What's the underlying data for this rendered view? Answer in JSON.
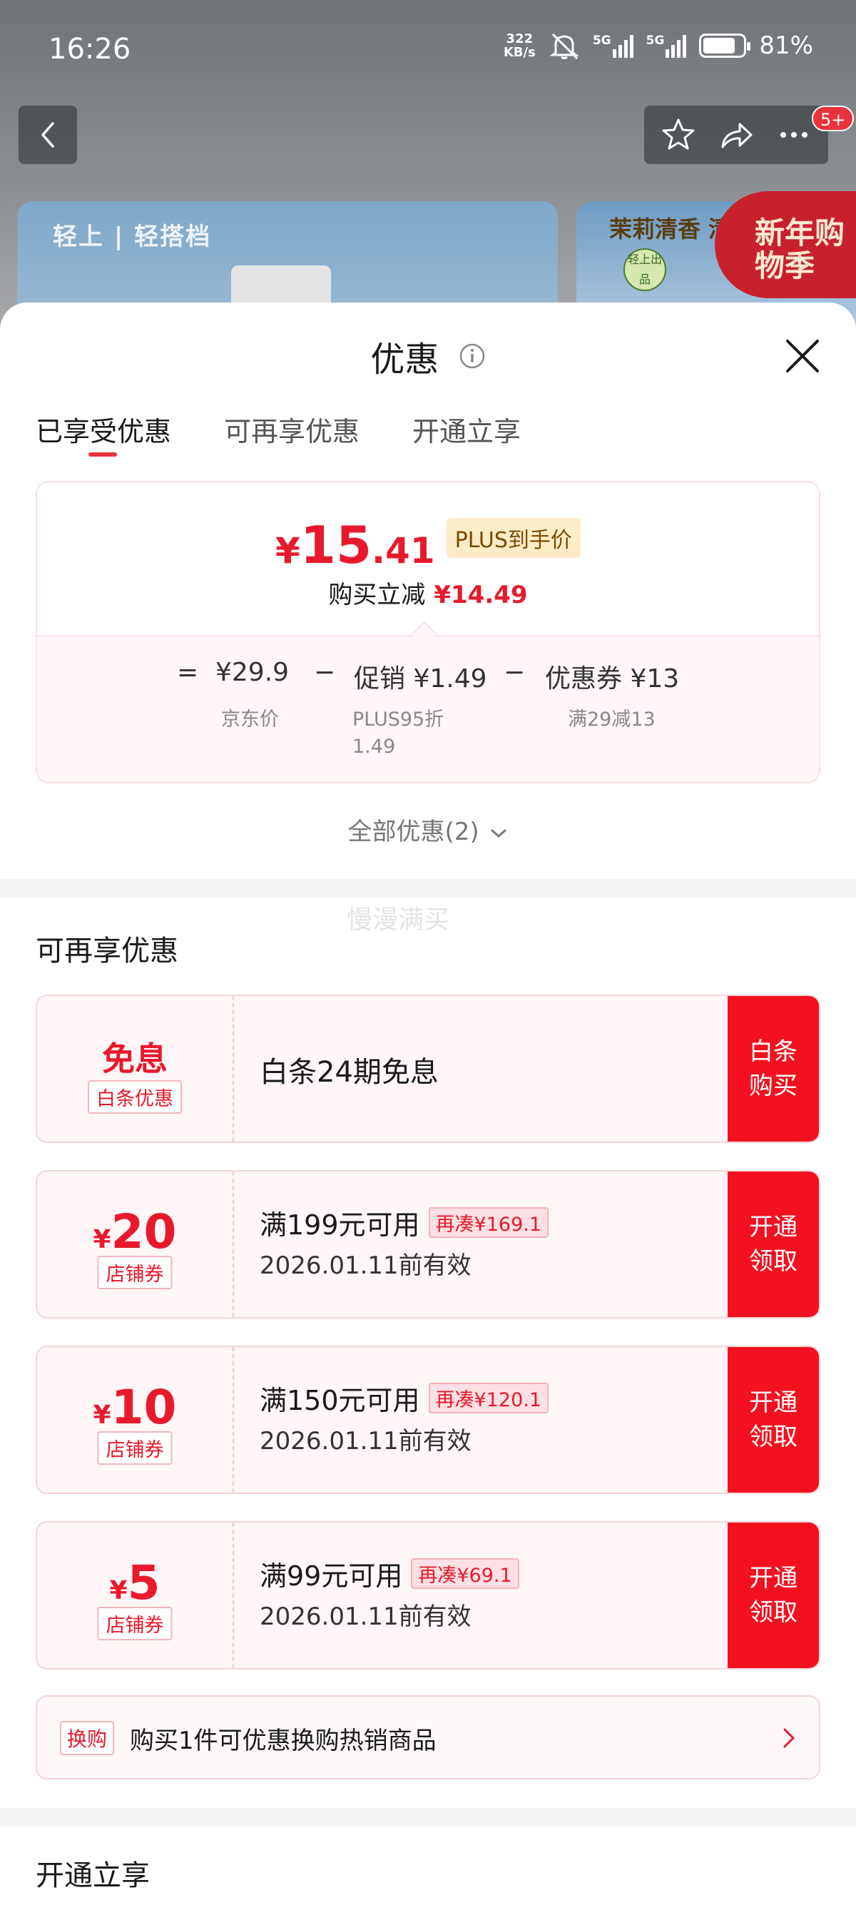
{
  "status_bar": {
    "time": "16:26",
    "speed": "322",
    "speed_unit": "KB/s",
    "net1": "5G",
    "net2": "5G",
    "battery": "81%"
  },
  "header": {
    "notification_count": "5+"
  },
  "banners": {
    "left_logo": "轻上 | 轻搭档",
    "right_title": "茉莉清香 清",
    "right_badge": "轻上出品",
    "promo": "新年购物季"
  },
  "sheet": {
    "title": "优惠",
    "tabs": [
      {
        "label": "已享受优惠",
        "active": true
      },
      {
        "label": "可再享优惠",
        "active": false
      },
      {
        "label": "开通立享",
        "active": false
      }
    ]
  },
  "price_card": {
    "currency": "¥",
    "price_int": "15",
    "price_dec": ".41",
    "plus_tag": "PLUS到手价",
    "reduce_label": "购买立减",
    "reduce_value": "¥14.49",
    "eq": "=",
    "minus1": "−",
    "minus2": "−",
    "jd_price": "¥29.9",
    "jd_price_label": "京东价",
    "promo": "促销 ¥1.49",
    "promo_label_1": "PLUS95折",
    "promo_label_2": "1.49",
    "coupon": "优惠券 ¥13",
    "coupon_label": "满29减13"
  },
  "all_offers": "全部优惠(2)",
  "watermark": "慢漫满买",
  "more_offers": {
    "title": "可再享优惠",
    "baitiao": {
      "title": "免息",
      "tag": "白条优惠",
      "desc": "白条24期免息",
      "action": "白条购买"
    },
    "coupons": [
      {
        "currency": "¥",
        "amount": "20",
        "tag": "店铺券",
        "condition": "满199元可用",
        "extra": "再凑¥169.1",
        "valid": "2026.01.11前有效",
        "action": "开通领取"
      },
      {
        "currency": "¥",
        "amount": "10",
        "tag": "店铺券",
        "condition": "满150元可用",
        "extra": "再凑¥120.1",
        "valid": "2026.01.11前有效",
        "action": "开通领取"
      },
      {
        "currency": "¥",
        "amount": "5",
        "tag": "店铺券",
        "condition": "满99元可用",
        "extra": "再凑¥69.1",
        "valid": "2026.01.11前有效",
        "action": "开通领取"
      }
    ],
    "swap": {
      "tag": "换购",
      "text": "购买1件可优惠换购热销商品"
    }
  },
  "open_section": {
    "title": "开通立享"
  },
  "colors": {
    "accent": "#e8192c",
    "action": "#f4111f",
    "plus_bg": "#fdecc8"
  }
}
